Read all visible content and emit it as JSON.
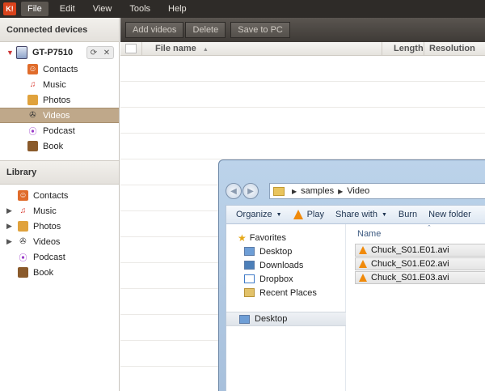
{
  "app": {
    "logo_text": "K!"
  },
  "menu": [
    "File",
    "Edit",
    "View",
    "Tools",
    "Help"
  ],
  "sidebar": {
    "connected_header": "Connected devices",
    "device": {
      "name": "GT-P7510",
      "sync_icon": "⟳",
      "close_icon": "✕"
    },
    "device_items": [
      {
        "label": "Contacts",
        "icon": "contacts-icon"
      },
      {
        "label": "Music",
        "icon": "music-icon"
      },
      {
        "label": "Photos",
        "icon": "photos-icon"
      },
      {
        "label": "Videos",
        "icon": "videos-icon",
        "selected": true
      },
      {
        "label": "Podcast",
        "icon": "podcast-icon"
      },
      {
        "label": "Book",
        "icon": "book-icon"
      }
    ],
    "library_header": "Library",
    "library_items": [
      {
        "label": "Contacts",
        "icon": "contacts-icon"
      },
      {
        "label": "Music",
        "icon": "music-icon",
        "expandable": true
      },
      {
        "label": "Photos",
        "icon": "photos-icon",
        "expandable": true
      },
      {
        "label": "Videos",
        "icon": "videos-icon",
        "expandable": true
      },
      {
        "label": "Podcast",
        "icon": "podcast-icon"
      },
      {
        "label": "Book",
        "icon": "book-icon"
      }
    ]
  },
  "toolbar": {
    "add_videos": "Add videos",
    "delete": "Delete",
    "save_to_pc": "Save to PC"
  },
  "filelist": {
    "col_name": "File name",
    "col_length": "Length",
    "col_resolution": "Resolution"
  },
  "explorer": {
    "breadcrumb": [
      "samples",
      "Video"
    ],
    "commands": {
      "organize": "Organize",
      "play": "Play",
      "share_with": "Share with",
      "burn": "Burn",
      "new_folder": "New folder"
    },
    "nav": {
      "favorites": "Favorites",
      "desktop": "Desktop",
      "downloads": "Downloads",
      "dropbox": "Dropbox",
      "recent_places": "Recent Places",
      "desktop_root": "Desktop"
    },
    "col_name": "Name",
    "files": [
      "Chuck_S01.E01.avi",
      "Chuck_S01.E02.avi",
      "Chuck_S01.E03.avi"
    ]
  },
  "colors": {
    "menubar_bg": "#2e2b28",
    "selected_nav": "#bfa88a",
    "toolbar_bg": "#4a4641",
    "explorer_frame": "#a7c0dc"
  }
}
